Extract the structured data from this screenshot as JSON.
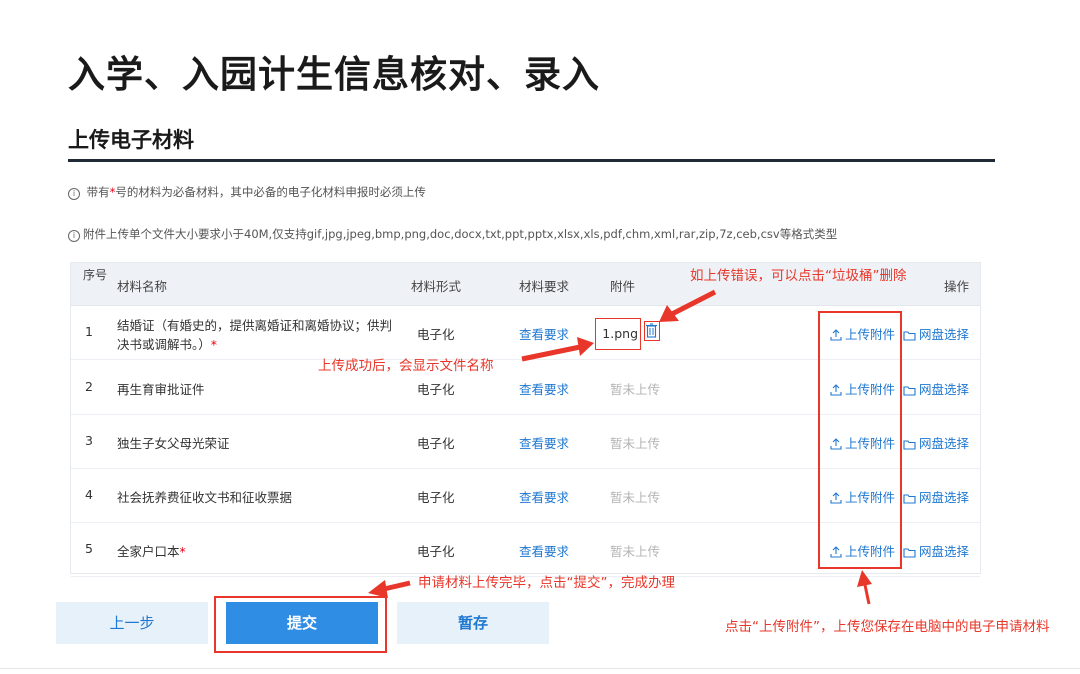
{
  "page_title": "入学、入园计生信息核对、录入",
  "section_title": "上传电子材料",
  "notices": {
    "required_prefix": "带有",
    "required_star": "*",
    "required_suffix": "号的材料为必备材料，其中必备的电子化材料申报时必须上传",
    "attachment": "附件上传单个文件大小要求小于40M,仅支持gif,jpg,jpeg,bmp,png,doc,docx,txt,ppt,pptx,xlsx,xls,pdf,chm,xml,rar,zip,7z,ceb,csv等格式类型",
    "info_icon": "i"
  },
  "table": {
    "headers": {
      "index": "序号",
      "name": "材料名称",
      "form": "材料形式",
      "requirement": "材料要求",
      "attachment": "附件",
      "operation": "操作"
    },
    "rows": [
      {
        "index": "1",
        "name": "结婚证（有婚史的，提供离婚证和离婚协议；供判决书或调解书。）",
        "star": "*",
        "form": "电子化",
        "requirement": "查看要求",
        "attachment": "1.png",
        "upload": "上传附件",
        "disk": "网盘选择"
      },
      {
        "index": "2",
        "name": "再生育审批证件",
        "star": "",
        "form": "电子化",
        "requirement": "查看要求",
        "attachment": "暂未上传",
        "upload": "上传附件",
        "disk": "网盘选择"
      },
      {
        "index": "3",
        "name": "独生子女父母光荣证",
        "star": "",
        "form": "电子化",
        "requirement": "查看要求",
        "attachment": "暂未上传",
        "upload": "上传附件",
        "disk": "网盘选择"
      },
      {
        "index": "4",
        "name": "社会抚养费征收文书和征收票据",
        "star": "",
        "form": "电子化",
        "requirement": "查看要求",
        "attachment": "暂未上传",
        "upload": "上传附件",
        "disk": "网盘选择"
      },
      {
        "index": "5",
        "name": "全家户口本",
        "star": "*",
        "form": "电子化",
        "requirement": "查看要求",
        "attachment": "暂未上传",
        "upload": "上传附件",
        "disk": "网盘选择"
      }
    ]
  },
  "annotations": {
    "trash_tip": "如上传错误，可以点击“垃圾桶”删除",
    "upload_ok_tip": "上传成功后，会显示文件名称",
    "submit_tip": "申请材料上传完毕，点击“提交”，完成办理",
    "upload_tip": "点击“上传附件”，上传您保存在电脑中的电子申请材料"
  },
  "buttons": {
    "prev": "上一步",
    "submit": "提交",
    "save": "暂存"
  },
  "icons": {
    "trash": "trash-icon",
    "upload": "upload-icon",
    "folder": "folder-icon",
    "info": "info-icon"
  },
  "colors": {
    "annotation_red": "#e8372a",
    "link_blue": "#1f78d1",
    "submit_blue": "#2f8de4",
    "required_red": "#e60012"
  }
}
